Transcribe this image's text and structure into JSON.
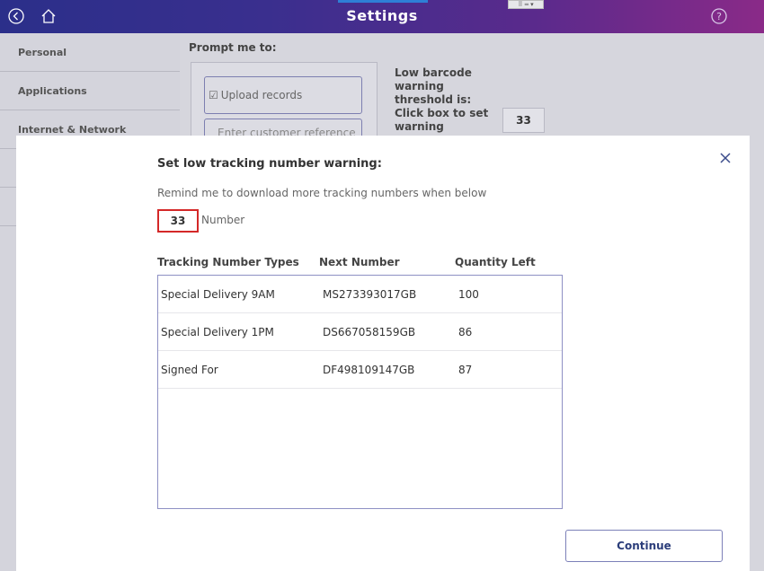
{
  "header": {
    "title": "Settings",
    "tab_indicator_color": "#2e7fd6",
    "icons": [
      "back-icon",
      "home-icon",
      "help-icon"
    ]
  },
  "sidebar": {
    "items": [
      {
        "label": "Personal"
      },
      {
        "label": "Applications"
      },
      {
        "label": "Internet & Network"
      },
      {
        "label": ""
      },
      {
        "label": ""
      }
    ]
  },
  "background": {
    "prompt_title": "Prompt me to:",
    "upload_records": "Upload records",
    "enter_customer_reference": "Enter customer reference",
    "threshold_text": "Low barcode warning threshold is: Click box to set warning",
    "threshold_value": "33"
  },
  "modal": {
    "title": "Set low tracking number warning:",
    "remind_text": "Remind me to download more tracking numbers when below",
    "number_value": "33",
    "number_label": "Number",
    "columns": [
      "Tracking Number Types",
      "Next Number",
      "Quantity Left"
    ],
    "rows": [
      {
        "type": "Special Delivery 9AM",
        "next": "MS273393017GB",
        "qty": "100"
      },
      {
        "type": "Special Delivery 1PM",
        "next": "DS667058159GB",
        "qty": "86"
      },
      {
        "type": "Signed For",
        "next": "DF498109147GB",
        "qty": "87"
      }
    ],
    "continue_label": "Continue",
    "highlight_color": "#d42828"
  }
}
